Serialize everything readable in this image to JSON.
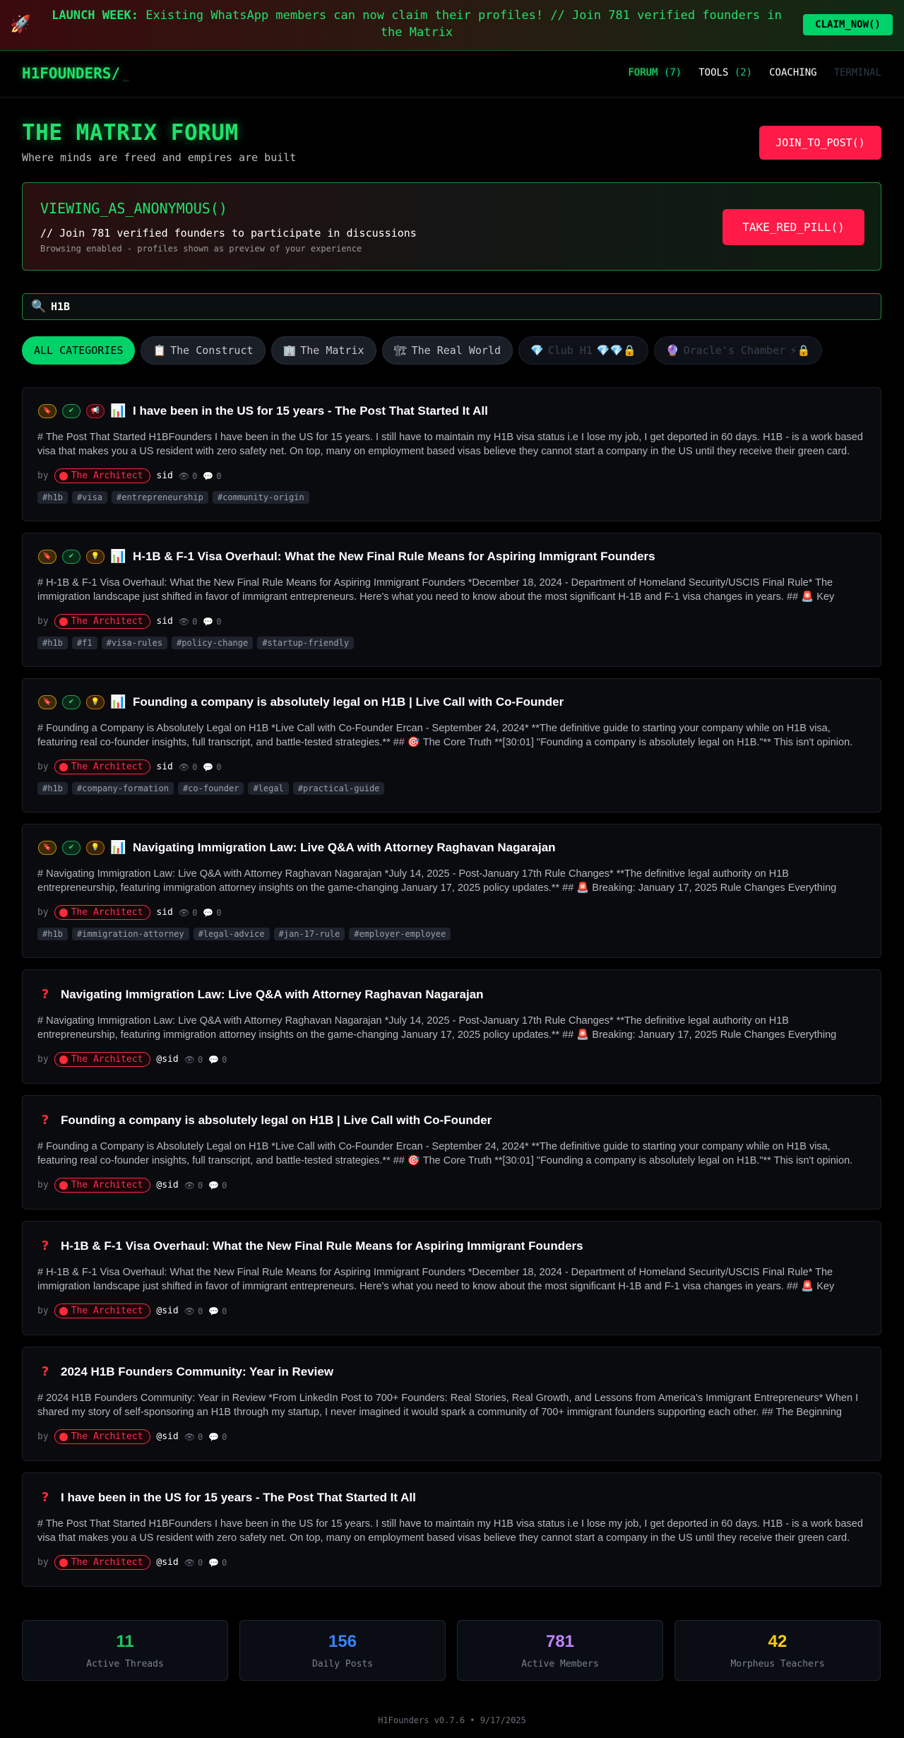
{
  "banner": {
    "icon": "rocket-icon",
    "rocket_glyph": "🚀",
    "label": "LAUNCH WEEK:",
    "message": "Existing WhatsApp members can now claim their profiles! // Join 781 verified founders in the Matrix",
    "cta": "CLAIM_NOW()"
  },
  "header": {
    "logo": "H1FOUNDERS/",
    "cursor": "_",
    "nav": {
      "forum": "FORUM",
      "forum_count": "(7)",
      "tools": "TOOLS",
      "tools_count": "(2)",
      "coaching": "COACHING",
      "terminal": "TERMINAL"
    }
  },
  "hero": {
    "title": "THE MATRIX FORUM",
    "subtitle": "Where minds are freed and empires are built",
    "join_button": "JOIN_TO_POST()"
  },
  "anon": {
    "title": "VIEWING_AS_ANONYMOUS()",
    "line1": "// Join 781 verified founders to participate in discussions",
    "line2": "Browsing enabled - profiles shown as preview of your experience",
    "button": "TAKE_RED_PILL()"
  },
  "search": {
    "value": "H1B",
    "icon": "search-icon",
    "glyph": "🔍"
  },
  "categories": [
    {
      "label": "ALL CATEGORIES",
      "emoji": ""
    },
    {
      "label": "The Construct",
      "emoji": "📋"
    },
    {
      "label": "The Matrix",
      "emoji": "🏢"
    },
    {
      "label": "The Real World",
      "emoji": "🏗"
    },
    {
      "label": "Club H1",
      "emoji": "💎",
      "suffix": "💎💎🔒"
    },
    {
      "label": "Oracle's Chamber",
      "emoji": "🔮",
      "suffix": "⚡🔒"
    }
  ],
  "posts": [
    {
      "title": "I have been in the US for 15 years - The Post That Started It All",
      "body": "# The Post That Started H1BFounders I have been in the US for 15 years. I still have to maintain my H1B visa status i.e I lose my job, I get deported in 60 days. H1B - is a work based visa that makes you a US resident with zero safety net. On top, many on employment based visas believe they cannot start a company in the US until they receive their green card.",
      "by": "by",
      "author": "The Architect",
      "handle": "sid",
      "views": "0",
      "comments": "0",
      "tags": [
        "#h1b",
        "#visa",
        "#entrepreneurship",
        "#community-origin"
      ]
    },
    {
      "title": "H-1B & F-1 Visa Overhaul: What the New Final Rule Means for Aspiring Immigrant Founders",
      "body": "# H-1B & F-1 Visa Overhaul: What the New Final Rule Means for Aspiring Immigrant Founders *December 18, 2024 - Department of Homeland Security/USCIS Final Rule* The immigration landscape just shifted in favor of immigrant entrepreneurs. Here's what you need to know about the most significant H-1B and F-1 visa changes in years. ## 🚨 Key Changes",
      "by": "by",
      "author": "The Architect",
      "handle": "sid",
      "views": "0",
      "comments": "0",
      "tags": [
        "#h1b",
        "#f1",
        "#visa-rules",
        "#policy-change",
        "#startup-friendly"
      ]
    },
    {
      "title": "Founding a company is absolutely legal on H1B | Live Call with Co-Founder",
      "body": "# Founding a Company is Absolutely Legal on H1B *Live Call with Co-Founder Ercan - September 24, 2024* **The definitive guide to starting your company while on H1B visa, featuring real co-founder insights, full transcript, and battle-tested strategies.** ## 🎯 The Core Truth **[30:01] \"Founding a company is absolutely legal on H1B.\"** This isn't opinion.",
      "by": "by",
      "author": "The Architect",
      "handle": "sid",
      "views": "0",
      "comments": "0",
      "tags": [
        "#h1b",
        "#company-formation",
        "#co-founder",
        "#legal",
        "#practical-guide"
      ]
    },
    {
      "title": "Navigating Immigration Law: Live Q&A with Attorney Raghavan Nagarajan",
      "body": "# Navigating Immigration Law: Live Q&A with Attorney Raghavan Nagarajan *July 14, 2025 - Post-January 17th Rule Changes* **The definitive legal authority on H1B entrepreneurship, featuring immigration attorney insights on the game-changing January 17, 2025 policy updates.** ## 🚨 Breaking: January 17, 2025 Rule Changes Everything",
      "by": "by",
      "author": "The Architect",
      "handle": "sid",
      "views": "0",
      "comments": "0",
      "tags": [
        "#h1b",
        "#immigration-attorney",
        "#legal-advice",
        "#jan-17-rule",
        "#employer-employee"
      ]
    },
    {
      "title": "Navigating Immigration Law: Live Q&A with Attorney Raghavan Nagarajan",
      "body": "# Navigating Immigration Law: Live Q&A with Attorney Raghavan Nagarajan *July 14, 2025 - Post-January 17th Rule Changes* **The definitive legal authority on H1B entrepreneurship, featuring immigration attorney insights on the game-changing January 17, 2025 policy updates.** ## 🚨 Breaking: January 17, 2025 Rule Changes Everything",
      "by": "by",
      "author": "The Architect",
      "handle": "@sid",
      "views": "0",
      "comments": "0",
      "tags": []
    },
    {
      "title": "Founding a company is absolutely legal on H1B | Live Call with Co-Founder",
      "body": "# Founding a Company is Absolutely Legal on H1B *Live Call with Co-Founder Ercan - September 24, 2024* **The definitive guide to starting your company while on H1B visa, featuring real co-founder insights, full transcript, and battle-tested strategies.** ## 🎯 The Core Truth **[30:01] \"Founding a company is absolutely legal on H1B.\"** This isn't opinion.",
      "by": "by",
      "author": "The Architect",
      "handle": "@sid",
      "views": "0",
      "comments": "0",
      "tags": []
    },
    {
      "title": "H-1B & F-1 Visa Overhaul: What the New Final Rule Means for Aspiring Immigrant Founders",
      "body": "# H-1B & F-1 Visa Overhaul: What the New Final Rule Means for Aspiring Immigrant Founders *December 18, 2024 - Department of Homeland Security/USCIS Final Rule* The immigration landscape just shifted in favor of immigrant entrepreneurs. Here's what you need to know about the most significant H-1B and F-1 visa changes in years. ## 🚨 Key Changes",
      "by": "by",
      "author": "The Architect",
      "handle": "@sid",
      "views": "0",
      "comments": "0",
      "tags": []
    },
    {
      "title": "2024 H1B Founders Community: Year in Review",
      "body": "# 2024 H1B Founders Community: Year in Review *From LinkedIn Post to 700+ Founders: Real Stories, Real Growth, and Lessons from America's Immigrant Entrepreneurs* When I shared my story of self-sponsoring an H1B through my startup, I never imagined it would spark a community of 700+ immigrant founders supporting each other. ## The Beginning",
      "by": "by",
      "author": "The Architect",
      "handle": "@sid",
      "views": "0",
      "comments": "0",
      "tags": []
    },
    {
      "title": "I have been in the US for 15 years - The Post That Started It All",
      "body": "# The Post That Started H1BFounders I have been in the US for 15 years. I still have to maintain my H1B visa status i.e I lose my job, I get deported in 60 days. H1B - is a work based visa that makes you a US resident with zero safety net. On top, many on employment based visas believe they cannot start a company in the US until they receive their green card.",
      "by": "by",
      "author": "The Architect",
      "handle": "@sid",
      "views": "0",
      "comments": "0",
      "tags": []
    }
  ],
  "stats": [
    {
      "value": "11",
      "label": "Active Threads",
      "color": "#22c55e"
    },
    {
      "value": "156",
      "label": "Daily Posts",
      "color": "#3b82f6"
    },
    {
      "value": "781",
      "label": "Active Members",
      "color": "#c084fc"
    },
    {
      "value": "42",
      "label": "Morpheus Teachers",
      "color": "#facc15"
    }
  ],
  "footer": "H1Founders v0.7.6 • 9/17/2025",
  "colors": {
    "accent": "#22e06b",
    "danger": "#ff1a47",
    "bg": "#000000"
  }
}
